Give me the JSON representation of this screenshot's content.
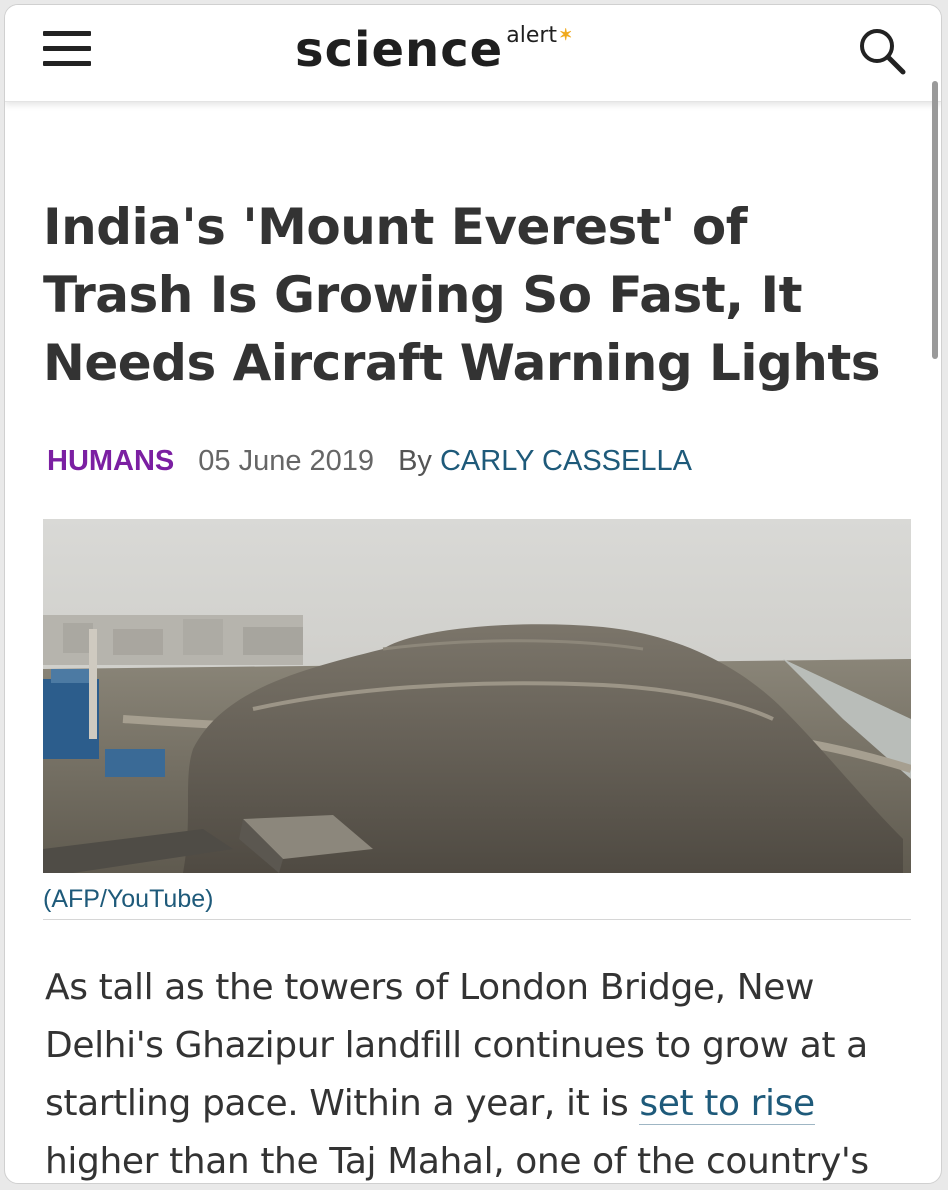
{
  "header": {
    "logo_main": "science",
    "logo_sub": "alert"
  },
  "article": {
    "title": "India's 'Mount Everest' of Trash Is Growing So Fast, It Needs Aircraft Warning Lights",
    "category": "HUMANS",
    "date": "05 June 2019",
    "by_label": "By",
    "author": "CARLY CASSELLA",
    "image_caption": "(AFP/YouTube)",
    "body_before_link": "As tall as the towers of London Bridge, New Delhi's Ghazipur landfill continues to grow at a startling pace. Within a year, it is ",
    "body_link": "set to rise",
    "body_after_link": " higher than the Taj Mahal, one of the country's most"
  },
  "icons": {
    "menu": "hamburger-menu-icon",
    "search": "magnifying-glass-icon",
    "logo_accent": "sun-spark-icon"
  },
  "colors": {
    "category": "#7b1fa2",
    "link": "#1e5a7a",
    "text": "#333333",
    "logo_accent": "#f0a91c"
  }
}
